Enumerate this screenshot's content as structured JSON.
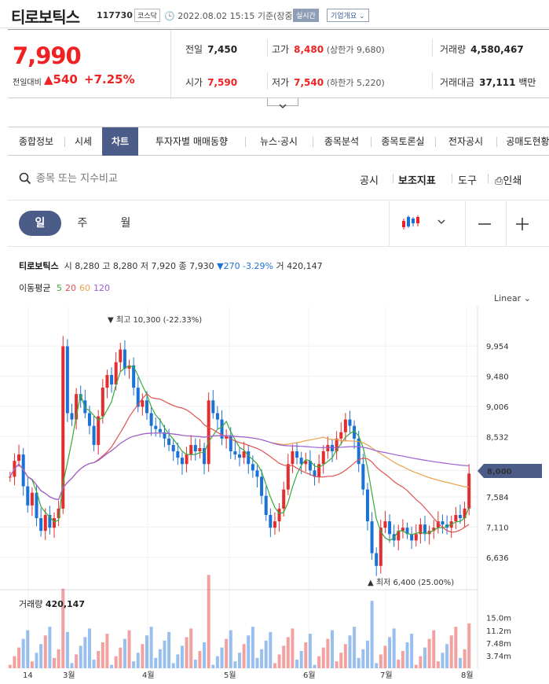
{
  "header": {
    "name": "티로보틱스",
    "code": "117730",
    "market": "코스닥",
    "datetime": "2022.08.02 15:15",
    "basis": "기준(장중)",
    "live_badge": "실시간",
    "company_btn": "기업개요"
  },
  "quote": {
    "price": "7,990",
    "change_label": "전일대비",
    "change": "540",
    "change_pct": "+7.25%",
    "prev_label": "전일",
    "prev": "7,450",
    "high_label": "고가",
    "high": "8,480",
    "upper_limit": "(상한가 9,680)",
    "volume_label": "거래량",
    "volume": "4,580,467",
    "open_label": "시가",
    "open": "7,590",
    "low_label": "저가",
    "low": "7,540",
    "lower_limit": "(하한가 5,220)",
    "amount_label": "거래대금",
    "amount": "37,111",
    "amount_unit": "백만"
  },
  "tabs": [
    "종합정보",
    "시세",
    "차트",
    "투자자별 매매동향",
    "뉴스·공시",
    "종목분석",
    "종목토론실",
    "전자공시",
    "공매도현황"
  ],
  "active_tab": "차트",
  "search": {
    "placeholder": "종목 또는 지수비교",
    "tools": [
      "공시",
      "보조지표",
      "도구",
      "인쇄"
    ]
  },
  "periods": [
    "일",
    "주",
    "월"
  ],
  "active_period": "일",
  "legend": {
    "name": "티로보틱스",
    "open_label": "시",
    "open": "8,280",
    "high_label": "고",
    "high": "8,280",
    "low_label": "저",
    "low": "7,920",
    "close_label": "종",
    "close": "7,930",
    "change": "▼270 -3.29%",
    "vol_label": "거",
    "vol": "420,147",
    "ma_label": "이동평균",
    "ma": [
      {
        "n": "5",
        "color": "#38a93b"
      },
      {
        "n": "20",
        "color": "#e0504f"
      },
      {
        "n": "60",
        "color": "#e8a24c"
      },
      {
        "n": "120",
        "color": "#9a5fd6"
      }
    ]
  },
  "scale_label": "Linear",
  "chart_data": {
    "type": "candlestick",
    "y_ticks": [
      "9,954",
      "9,480",
      "9,006",
      "8,532",
      "8,000",
      "7,584",
      "7,110",
      "6,636"
    ],
    "current_price_tag": "8,000",
    "max_annotation": "최고 10,300 (-22.33%)",
    "min_annotation": "최저 6,400 (25.00%)",
    "x_labels": [
      "14",
      "3월",
      "4월",
      "5월",
      "6월",
      "7월",
      "8월"
    ],
    "volume_label": "거래량",
    "volume_value": "420,147",
    "volume_ticks": [
      "15.0m",
      "11.2m",
      "7.48m",
      "3.74m"
    ],
    "colors": {
      "up": "#e22e2e",
      "down": "#1b72d6"
    }
  }
}
